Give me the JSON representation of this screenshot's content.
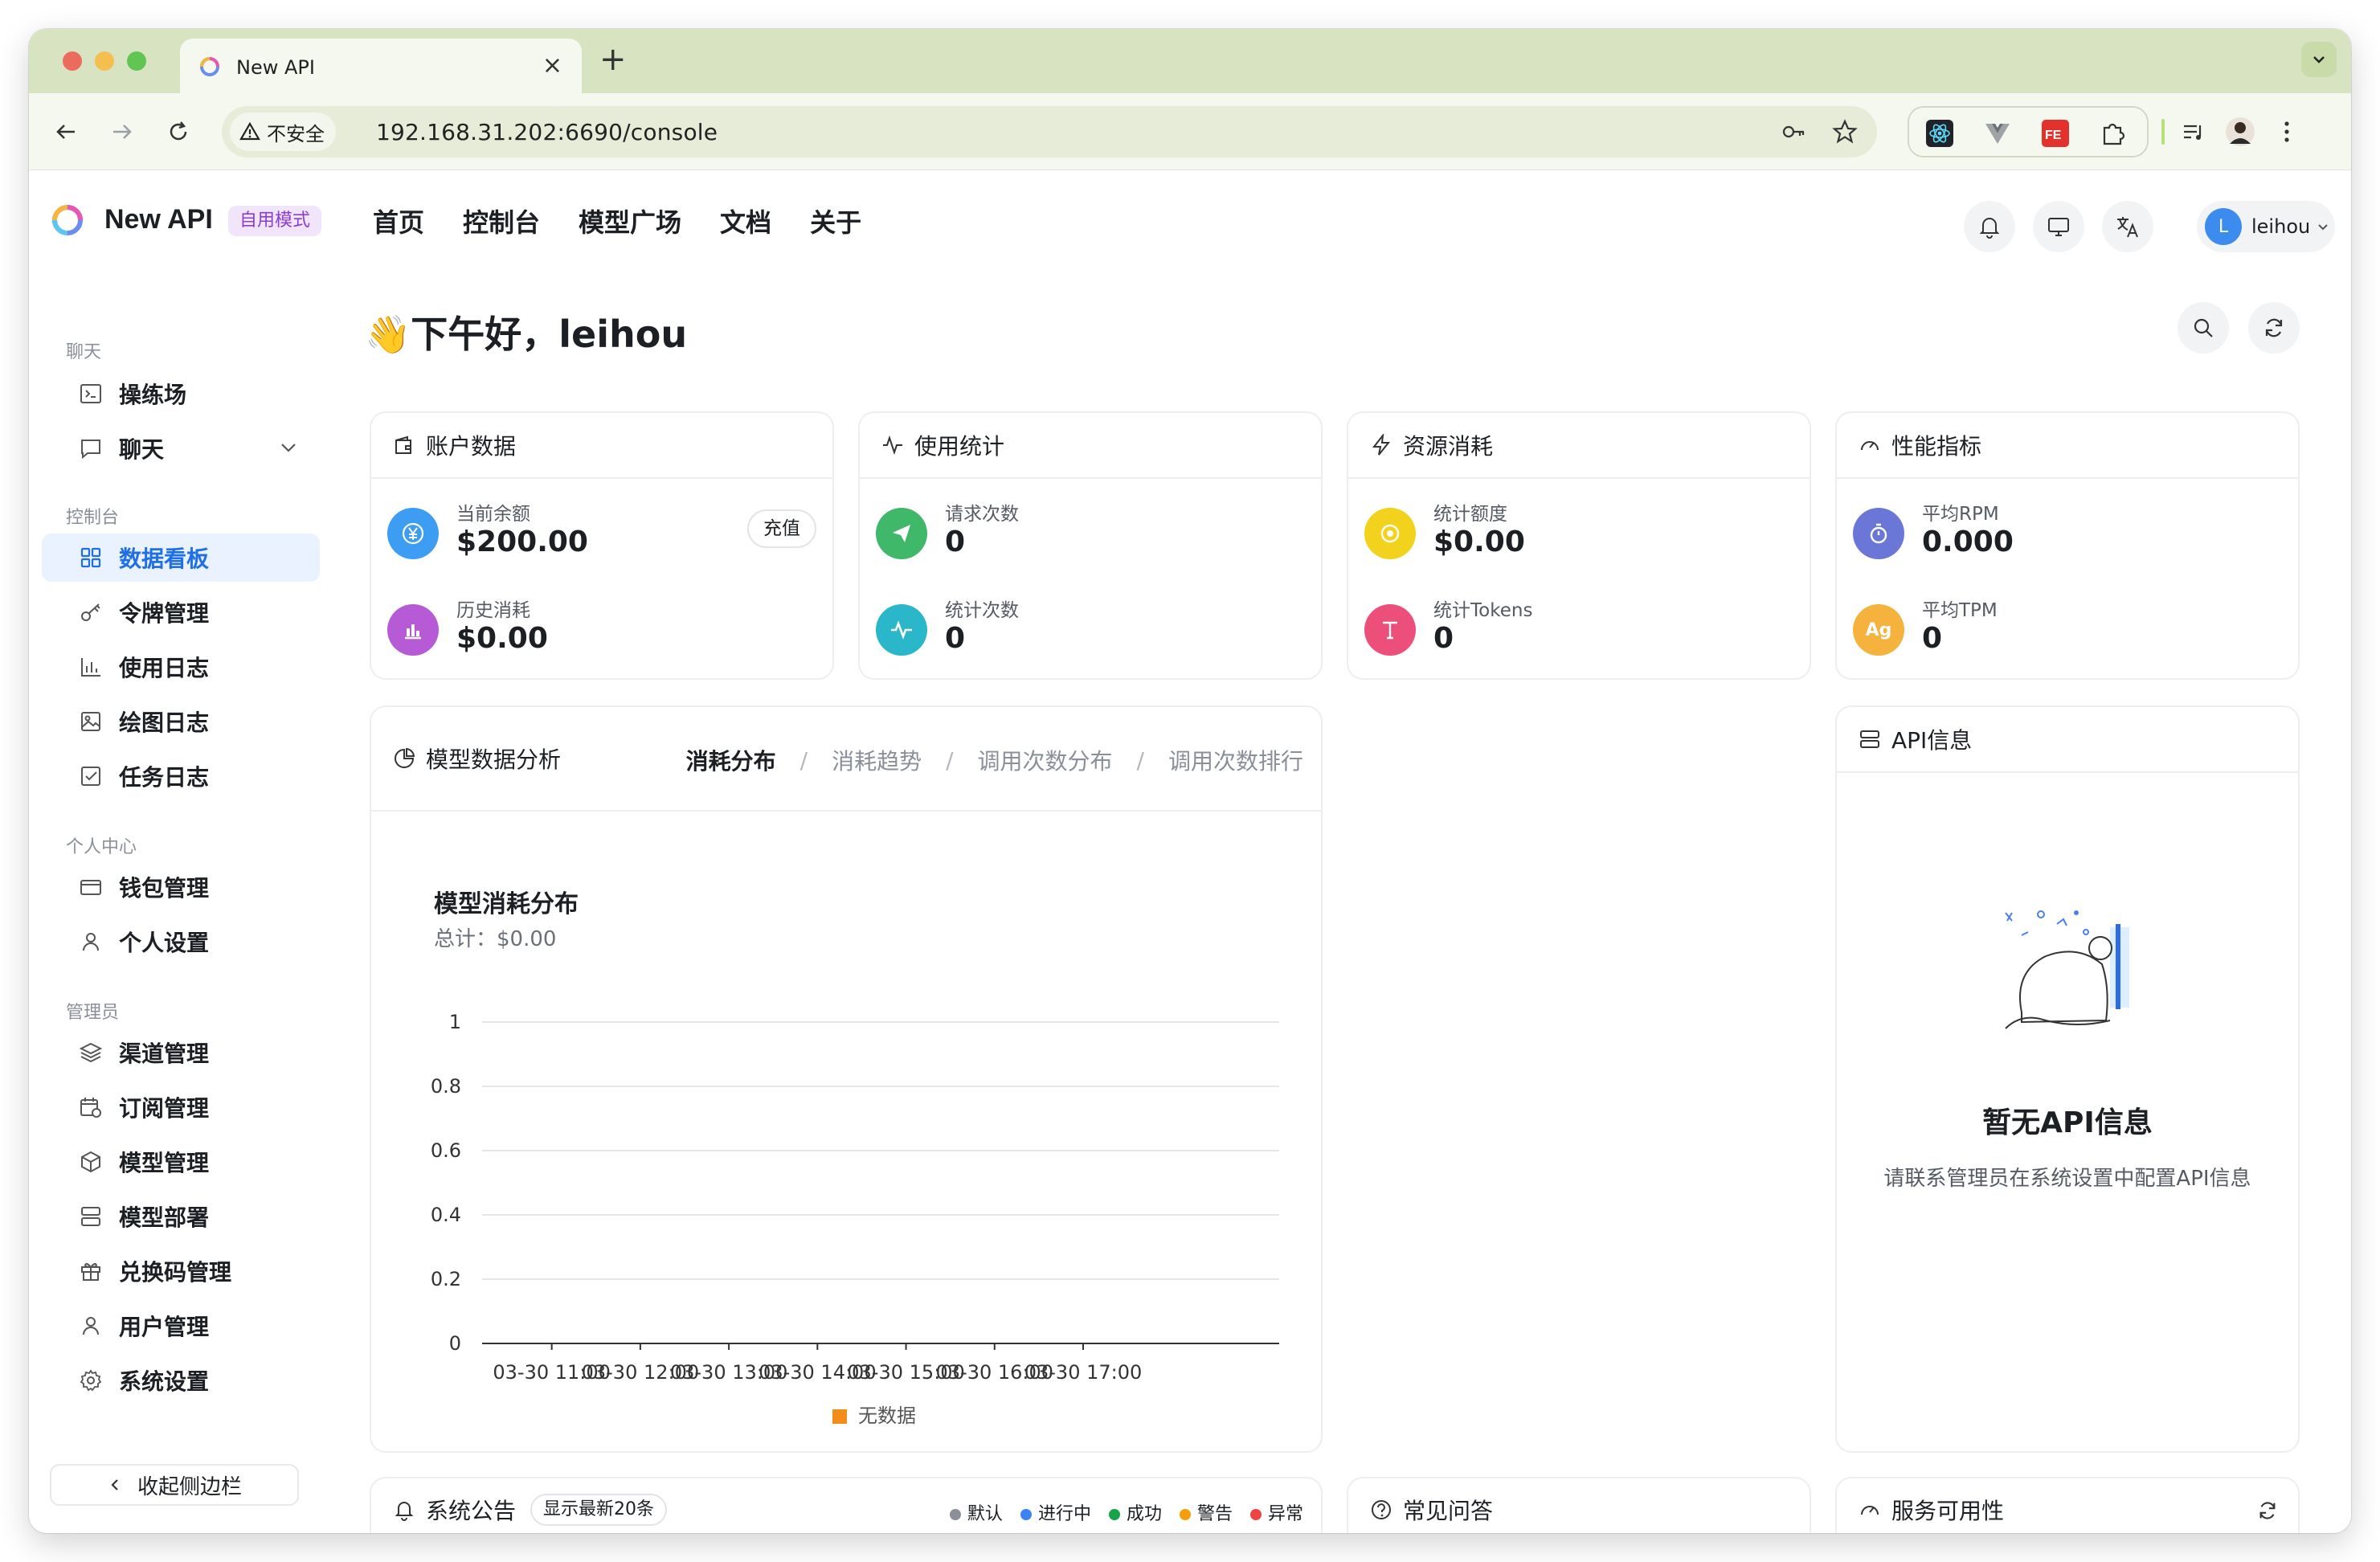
{
  "browser": {
    "tab_title": "New API",
    "security_label": "不安全",
    "url": "192.168.31.202:6690/console"
  },
  "header": {
    "brand": "New API",
    "mode_badge": "自用模式",
    "nav": [
      "首页",
      "控制台",
      "模型广场",
      "文档",
      "关于"
    ],
    "user_initial": "L",
    "user_name": "leihou"
  },
  "sidebar": {
    "groups": {
      "chat": "聊天",
      "console": "控制台",
      "personal": "个人中心",
      "admin": "管理员"
    },
    "items": {
      "playground": "操练场",
      "chat": "聊天",
      "dashboard": "数据看板",
      "tokens": "令牌管理",
      "usage_logs": "使用日志",
      "drawing_logs": "绘图日志",
      "task_logs": "任务日志",
      "wallet": "钱包管理",
      "personal_settings": "个人设置",
      "channels": "渠道管理",
      "subscriptions": "订阅管理",
      "models": "模型管理",
      "deployments": "模型部署",
      "redeem_codes": "兑换码管理",
      "users": "用户管理",
      "system_settings": "系统设置"
    },
    "collapse_label": "收起侧边栏"
  },
  "greeting": "👋下午好，leihou",
  "cards": {
    "account": {
      "title": "账户数据",
      "balance_label": "当前余额",
      "balance_value": "$200.00",
      "recharge": "充值",
      "history_label": "历史消耗",
      "history_value": "$0.00"
    },
    "usage": {
      "title": "使用统计",
      "requests_label": "请求次数",
      "requests_value": "0",
      "count_label": "统计次数",
      "count_value": "0"
    },
    "resource": {
      "title": "资源消耗",
      "quota_label": "统计额度",
      "quota_value": "$0.00",
      "tokens_label": "统计Tokens",
      "tokens_value": "0"
    },
    "performance": {
      "title": "性能指标",
      "rpm_label": "平均RPM",
      "rpm_value": "0.000",
      "tpm_label": "平均TPM",
      "tpm_value": "0",
      "tpm_icon_text": "Ag"
    }
  },
  "analysis": {
    "title": "模型数据分析",
    "tabs": [
      "消耗分布",
      "消耗趋势",
      "调用次数分布",
      "调用次数排行"
    ],
    "active_tab": "消耗分布"
  },
  "api_info": {
    "title": "API信息",
    "empty_title": "暂无API信息",
    "empty_desc": "请联系管理员在系统设置中配置API信息"
  },
  "announcements": {
    "title": "系统公告",
    "count_badge": "显示最新20条",
    "legend": [
      {
        "label": "默认",
        "color": "#8a8f99"
      },
      {
        "label": "进行中",
        "color": "#3b82f6"
      },
      {
        "label": "成功",
        "color": "#16a34a"
      },
      {
        "label": "警告",
        "color": "#f59e0b"
      },
      {
        "label": "异常",
        "color": "#ef4444"
      }
    ]
  },
  "faq": {
    "title": "常见问答"
  },
  "service": {
    "title": "服务可用性"
  },
  "chart_data": {
    "type": "bar",
    "title": "模型消耗分布",
    "subtitle": "总计：$0.00",
    "categories": [
      "03-30 11:00",
      "03-30 12:00",
      "03-30 13:00",
      "03-30 14:00",
      "03-30 15:00",
      "03-30 16:00",
      "03-30 17:00"
    ],
    "series": [
      {
        "name": "无数据",
        "values": [
          0,
          0,
          0,
          0,
          0,
          0,
          0
        ],
        "color": "#f28c1a"
      }
    ],
    "yticks": [
      "0",
      "0.2",
      "0.4",
      "0.6",
      "0.8",
      "1"
    ],
    "ylim": [
      0,
      1
    ],
    "grid": true,
    "legend_position": "bottom"
  },
  "colors": {
    "accent": "#1f6fe6",
    "balance_icon": "#3d9df2",
    "history_icon": "#b75ad6",
    "requests_icon": "#3fb86a",
    "count_icon": "#2ab7c9",
    "quota_icon": "#f2d21c",
    "tokens_icon": "#ec4f7a",
    "rpm_icon": "#6b77d6",
    "tpm_icon": "#f5b23c"
  }
}
